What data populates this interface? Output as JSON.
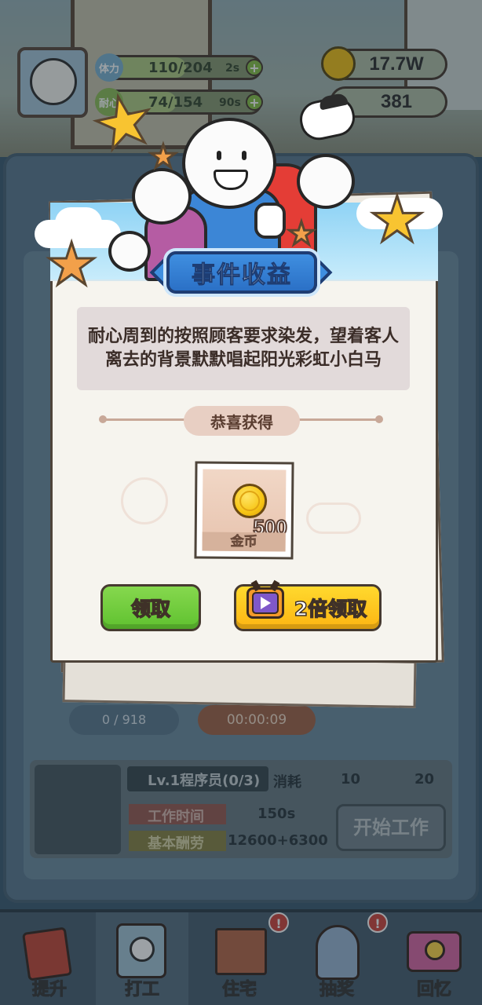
{
  "hud": {
    "stamina": {
      "label": "体力",
      "value": "110/204",
      "timer": "2s",
      "fill": 0.54
    },
    "patience": {
      "label": "耐心",
      "value": "74/154",
      "timer": "90s",
      "fill": 0.48
    },
    "coins": "17.7W",
    "gems": "381"
  },
  "modal": {
    "title": "事件收益",
    "description": "耐心周到的按照顾客要求染发，望着客人离去的背景默默唱起阳光彩虹小白马",
    "congrats": "恭喜获得",
    "reward": {
      "amount": "500",
      "name": "金币",
      "icon": "gold-coin-icon"
    },
    "claim_label": "领取",
    "double_claim_label": "2倍领取"
  },
  "background_panel": {
    "progress": "0 / 918",
    "timer": "00:00:09",
    "worker": {
      "level": "Lv.1程序员(0/3)",
      "cost_label": "消耗",
      "cost_patience": "10",
      "cost_stamina": "20",
      "work_time_label": "工作时间",
      "work_time": "150s",
      "base_pay_label": "基本酬劳",
      "base_pay": "12600+6300",
      "start_label": "开始工作"
    }
  },
  "nav": [
    {
      "label": "提升",
      "icon": "book-icon",
      "badge": ""
    },
    {
      "label": "打工",
      "icon": "work-badge-icon",
      "badge": ""
    },
    {
      "label": "住宅",
      "icon": "house-icon",
      "badge": "!"
    },
    {
      "label": "抽奖",
      "icon": "gacha-icon",
      "badge": "!"
    },
    {
      "label": "回忆",
      "icon": "camera-icon",
      "badge": ""
    }
  ],
  "colors": {
    "title_blue": "#2b70c6",
    "claim_green": "#5fc12f",
    "double_yellow": "#fdb512",
    "paper": "#f6f4ee",
    "star_yellow": "#f8c431"
  }
}
